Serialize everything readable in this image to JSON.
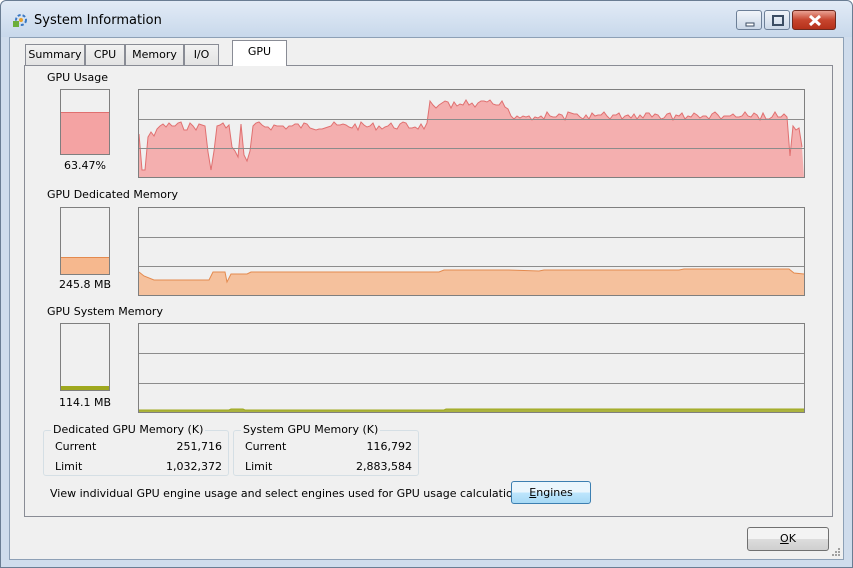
{
  "window": {
    "title": "System Information"
  },
  "tabs": [
    {
      "label": "Summary",
      "active": false
    },
    {
      "label": "CPU",
      "active": false
    },
    {
      "label": "Memory",
      "active": false
    },
    {
      "label": "I/O",
      "active": false
    },
    {
      "label": "GPU",
      "active": true
    }
  ],
  "gpu_usage": {
    "label": "GPU Usage",
    "value": "63.47%",
    "level": 0.6347
  },
  "dedicated_memory": {
    "label": "GPU Dedicated Memory",
    "value": "245.8 MB",
    "level": 0.24
  },
  "system_memory": {
    "label": "GPU System Memory",
    "value": "114.1 MB",
    "level": 0.04
  },
  "dedicated_group": {
    "title": "Dedicated GPU Memory (K)",
    "current_label": "Current",
    "current_value": "251,716",
    "limit_label": "Limit",
    "limit_value": "1,032,372"
  },
  "system_group": {
    "title": "System GPU Memory (K)",
    "current_label": "Current",
    "current_value": "116,792",
    "limit_label": "Limit",
    "limit_value": "2,883,584"
  },
  "engines": {
    "description": "View individual GPU engine usage and select engines used for GPU usage calculations:",
    "button_label_prefix": "",
    "button_accel": "E",
    "button_label_rest": "ngines"
  },
  "ok_button": {
    "accel": "O",
    "rest": "K"
  },
  "colors": {
    "usage": "#f4a3a3",
    "usage_line": "#e07070",
    "dedicated": "#f6b88e",
    "dedicated_line": "#e48a4e",
    "system": "#9fa81e"
  }
}
